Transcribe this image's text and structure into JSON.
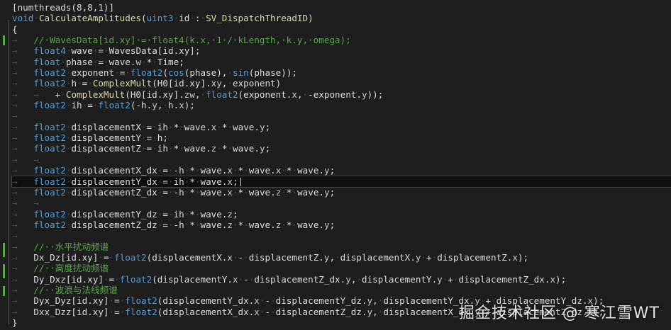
{
  "editor": {
    "lines": [
      [
        [
          "pl",
          "[numthreads(8,8,1)]"
        ]
      ],
      [
        [
          "kw",
          "void"
        ],
        [
          "ws",
          "·"
        ],
        [
          "fn",
          "CalculateAmplitudes"
        ],
        [
          "pl",
          "("
        ],
        [
          "kw",
          "uint3"
        ],
        [
          "ws",
          "·"
        ],
        [
          "id",
          "id"
        ],
        [
          "ws",
          "·"
        ],
        [
          "pl",
          ":"
        ],
        [
          "ws",
          "·"
        ],
        [
          "sm",
          "SV_DispatchThreadID"
        ],
        [
          "pl",
          ")"
        ]
      ],
      [
        [
          "pl",
          "{"
        ]
      ],
      [
        [
          "ws",
          "→   "
        ],
        [
          "cm",
          "//·WavesData[id.xy]·=·float4(k.x,·1·/·kLength,·k.y,·omega);"
        ]
      ],
      [
        [
          "ws",
          "→   "
        ],
        [
          "kw",
          "float4"
        ],
        [
          "ws",
          "·"
        ],
        [
          "id",
          "wave"
        ],
        [
          "ws",
          "·"
        ],
        [
          "pl",
          "="
        ],
        [
          "ws",
          "·"
        ],
        [
          "id",
          "WavesData[id.xy];"
        ]
      ],
      [
        [
          "ws",
          "→   "
        ],
        [
          "kw",
          "float"
        ],
        [
          "ws",
          "·"
        ],
        [
          "id",
          "phase"
        ],
        [
          "ws",
          "·"
        ],
        [
          "pl",
          "="
        ],
        [
          "ws",
          "·"
        ],
        [
          "id",
          "wave."
        ],
        [
          "mb",
          "w"
        ],
        [
          "ws",
          "·"
        ],
        [
          "pl",
          "*"
        ],
        [
          "ws",
          "·"
        ],
        [
          "id",
          "Time;"
        ]
      ],
      [
        [
          "ws",
          "→   "
        ],
        [
          "kw",
          "float2"
        ],
        [
          "ws",
          "·"
        ],
        [
          "id",
          "exponent"
        ],
        [
          "ws",
          "·"
        ],
        [
          "pl",
          "="
        ],
        [
          "ws",
          "·"
        ],
        [
          "kw",
          "float2"
        ],
        [
          "pl",
          "("
        ],
        [
          "kw",
          "cos"
        ],
        [
          "pl",
          "(phase),"
        ],
        [
          "ws",
          "·"
        ],
        [
          "kw",
          "sin"
        ],
        [
          "pl",
          "(phase));"
        ]
      ],
      [
        [
          "ws",
          "→   "
        ],
        [
          "kw",
          "float2"
        ],
        [
          "ws",
          "·"
        ],
        [
          "id",
          "h"
        ],
        [
          "ws",
          "·"
        ],
        [
          "pl",
          "="
        ],
        [
          "ws",
          "·"
        ],
        [
          "fn",
          "ComplexMult"
        ],
        [
          "pl",
          "(H0[id.xy]."
        ],
        [
          "mb",
          "xy"
        ],
        [
          "pl",
          ","
        ],
        [
          "ws",
          "·"
        ],
        [
          "id",
          "exponent)"
        ]
      ],
      [
        [
          "ws",
          "→   →   "
        ],
        [
          "pl",
          "+"
        ],
        [
          "ws",
          "·"
        ],
        [
          "fn",
          "ComplexMult"
        ],
        [
          "pl",
          "(H0[id.xy]."
        ],
        [
          "mb",
          "zw"
        ],
        [
          "pl",
          ","
        ],
        [
          "ws",
          "·"
        ],
        [
          "kw",
          "float2"
        ],
        [
          "pl",
          "(exponent."
        ],
        [
          "mb",
          "x"
        ],
        [
          "pl",
          ","
        ],
        [
          "ws",
          "·"
        ],
        [
          "pl",
          "-exponent."
        ],
        [
          "mb",
          "y"
        ],
        [
          "pl",
          "));"
        ]
      ],
      [
        [
          "ws",
          "→   "
        ],
        [
          "kw",
          "float2"
        ],
        [
          "ws",
          "·"
        ],
        [
          "id",
          "ih"
        ],
        [
          "ws",
          "·"
        ],
        [
          "pl",
          "="
        ],
        [
          "ws",
          "·"
        ],
        [
          "kw",
          "float2"
        ],
        [
          "pl",
          "(-h."
        ],
        [
          "mb",
          "y"
        ],
        [
          "pl",
          ","
        ],
        [
          "ws",
          "·"
        ],
        [
          "pl",
          "h."
        ],
        [
          "mb",
          "x"
        ],
        [
          "pl",
          ");"
        ]
      ],
      [
        [
          "ws",
          "→   "
        ]
      ],
      [
        [
          "ws",
          "→   "
        ],
        [
          "kw",
          "float2"
        ],
        [
          "ws",
          "·"
        ],
        [
          "id",
          "displacementX"
        ],
        [
          "ws",
          "·"
        ],
        [
          "pl",
          "="
        ],
        [
          "ws",
          "·"
        ],
        [
          "id",
          "ih"
        ],
        [
          "ws",
          "·"
        ],
        [
          "pl",
          "*"
        ],
        [
          "ws",
          "·"
        ],
        [
          "id",
          "wave."
        ],
        [
          "mb",
          "x"
        ],
        [
          "ws",
          "·"
        ],
        [
          "pl",
          "*"
        ],
        [
          "ws",
          "·"
        ],
        [
          "id",
          "wave."
        ],
        [
          "mb",
          "y"
        ],
        [
          "pl",
          ";"
        ]
      ],
      [
        [
          "ws",
          "→   "
        ],
        [
          "kw",
          "float2"
        ],
        [
          "ws",
          "·"
        ],
        [
          "id",
          "displacementY"
        ],
        [
          "ws",
          "·"
        ],
        [
          "pl",
          "="
        ],
        [
          "ws",
          "·"
        ],
        [
          "id",
          "h;"
        ]
      ],
      [
        [
          "ws",
          "→   "
        ],
        [
          "kw",
          "float2"
        ],
        [
          "ws",
          "·"
        ],
        [
          "id",
          "displacementZ"
        ],
        [
          "ws",
          "·"
        ],
        [
          "pl",
          "="
        ],
        [
          "ws",
          "·"
        ],
        [
          "id",
          "ih"
        ],
        [
          "ws",
          "·"
        ],
        [
          "pl",
          "*"
        ],
        [
          "ws",
          "·"
        ],
        [
          "id",
          "wave."
        ],
        [
          "mb",
          "z"
        ],
        [
          "ws",
          "·"
        ],
        [
          "pl",
          "*"
        ],
        [
          "ws",
          "·"
        ],
        [
          "id",
          "wave."
        ],
        [
          "mb",
          "y"
        ],
        [
          "pl",
          ";"
        ]
      ],
      [
        [
          "ws",
          "→   →"
        ]
      ],
      [
        [
          "ws",
          "→   "
        ],
        [
          "kw",
          "float2"
        ],
        [
          "ws",
          "·"
        ],
        [
          "id",
          "displacementX_dx"
        ],
        [
          "ws",
          "·"
        ],
        [
          "pl",
          "="
        ],
        [
          "ws",
          "·"
        ],
        [
          "pl",
          "-h"
        ],
        [
          "ws",
          "·"
        ],
        [
          "pl",
          "*"
        ],
        [
          "ws",
          "·"
        ],
        [
          "id",
          "wave."
        ],
        [
          "mb",
          "x"
        ],
        [
          "ws",
          "·"
        ],
        [
          "pl",
          "*"
        ],
        [
          "ws",
          "·"
        ],
        [
          "id",
          "wave."
        ],
        [
          "mb",
          "x"
        ],
        [
          "ws",
          "·"
        ],
        [
          "pl",
          "*"
        ],
        [
          "ws",
          "·"
        ],
        [
          "id",
          "wave."
        ],
        [
          "mb",
          "y"
        ],
        [
          "pl",
          ";"
        ]
      ],
      [
        [
          "ws",
          "→   "
        ],
        [
          "kw",
          "float2"
        ],
        [
          "ws",
          "·"
        ],
        [
          "id",
          "displacementY_dx"
        ],
        [
          "ws",
          "·"
        ],
        [
          "pl",
          "="
        ],
        [
          "ws",
          "·"
        ],
        [
          "id",
          "ih"
        ],
        [
          "ws",
          "·"
        ],
        [
          "pl",
          "*"
        ],
        [
          "ws",
          "·"
        ],
        [
          "id",
          "wave."
        ],
        [
          "mb",
          "x"
        ],
        [
          "pl",
          ";"
        ]
      ],
      [
        [
          "ws",
          "→   "
        ],
        [
          "kw",
          "float2"
        ],
        [
          "ws",
          "·"
        ],
        [
          "id",
          "displacementZ_dx"
        ],
        [
          "ws",
          "·"
        ],
        [
          "pl",
          "="
        ],
        [
          "ws",
          "·"
        ],
        [
          "pl",
          "-h"
        ],
        [
          "ws",
          "·"
        ],
        [
          "pl",
          "*"
        ],
        [
          "ws",
          "·"
        ],
        [
          "id",
          "wave."
        ],
        [
          "mb",
          "x"
        ],
        [
          "ws",
          "·"
        ],
        [
          "pl",
          "*"
        ],
        [
          "ws",
          "·"
        ],
        [
          "id",
          "wave."
        ],
        [
          "mb",
          "z"
        ],
        [
          "ws",
          "·"
        ],
        [
          "pl",
          "*"
        ],
        [
          "ws",
          "·"
        ],
        [
          "id",
          "wave."
        ],
        [
          "mb",
          "y"
        ],
        [
          "pl",
          ";"
        ]
      ],
      [
        [
          "ws",
          "→   →"
        ]
      ],
      [
        [
          "ws",
          "→   "
        ],
        [
          "kw",
          "float2"
        ],
        [
          "ws",
          "·"
        ],
        [
          "id",
          "displacementY_dz"
        ],
        [
          "ws",
          "·"
        ],
        [
          "pl",
          "="
        ],
        [
          "ws",
          "·"
        ],
        [
          "id",
          "ih"
        ],
        [
          "ws",
          "·"
        ],
        [
          "pl",
          "*"
        ],
        [
          "ws",
          "·"
        ],
        [
          "id",
          "wave."
        ],
        [
          "mb",
          "z"
        ],
        [
          "pl",
          ";"
        ]
      ],
      [
        [
          "ws",
          "→   "
        ],
        [
          "kw",
          "float2"
        ],
        [
          "ws",
          "·"
        ],
        [
          "id",
          "displacementZ_dz"
        ],
        [
          "ws",
          "·"
        ],
        [
          "pl",
          "="
        ],
        [
          "ws",
          "·"
        ],
        [
          "pl",
          "-h"
        ],
        [
          "ws",
          "·"
        ],
        [
          "pl",
          "*"
        ],
        [
          "ws",
          "·"
        ],
        [
          "id",
          "wave."
        ],
        [
          "mb",
          "z"
        ],
        [
          "ws",
          "·"
        ],
        [
          "pl",
          "*"
        ],
        [
          "ws",
          "·"
        ],
        [
          "id",
          "wave."
        ],
        [
          "mb",
          "z"
        ],
        [
          "ws",
          "·"
        ],
        [
          "pl",
          "*"
        ],
        [
          "ws",
          "·"
        ],
        [
          "id",
          "wave."
        ],
        [
          "mb",
          "y"
        ],
        [
          "pl",
          ";"
        ]
      ],
      [
        [
          "ws",
          "→   "
        ]
      ],
      [
        [
          "ws",
          "→   "
        ],
        [
          "cm",
          "//··水平扰动频谱"
        ]
      ],
      [
        [
          "ws",
          "→   "
        ],
        [
          "id",
          "Dx_Dz[id.xy]"
        ],
        [
          "ws",
          "·"
        ],
        [
          "pl",
          "="
        ],
        [
          "ws",
          "·"
        ],
        [
          "kw",
          "float2"
        ],
        [
          "pl",
          "(displacementX."
        ],
        [
          "mb",
          "x"
        ],
        [
          "ws",
          "·"
        ],
        [
          "pl",
          "-"
        ],
        [
          "ws",
          "·"
        ],
        [
          "id",
          "displacementZ."
        ],
        [
          "mb",
          "y"
        ],
        [
          "pl",
          ","
        ],
        [
          "ws",
          "·"
        ],
        [
          "id",
          "displacementX."
        ],
        [
          "mb",
          "y"
        ],
        [
          "ws",
          "·"
        ],
        [
          "pl",
          "+"
        ],
        [
          "ws",
          "·"
        ],
        [
          "id",
          "displacementZ."
        ],
        [
          "mb",
          "x"
        ],
        [
          "pl",
          ");"
        ]
      ],
      [
        [
          "ws",
          "→   "
        ],
        [
          "cm",
          "//··高度扰动频谱"
        ]
      ],
      [
        [
          "ws",
          "→   "
        ],
        [
          "id",
          "Dy_Dxz[id.xy]"
        ],
        [
          "ws",
          "·"
        ],
        [
          "pl",
          "="
        ],
        [
          "ws",
          "·"
        ],
        [
          "kw",
          "float2"
        ],
        [
          "pl",
          "(displacementY."
        ],
        [
          "mb",
          "x"
        ],
        [
          "ws",
          "·"
        ],
        [
          "pl",
          "-"
        ],
        [
          "ws",
          "·"
        ],
        [
          "id",
          "displacementZ_dx."
        ],
        [
          "mb",
          "y"
        ],
        [
          "pl",
          ","
        ],
        [
          "ws",
          "·"
        ],
        [
          "id",
          "displacementY."
        ],
        [
          "mb",
          "y"
        ],
        [
          "ws",
          "·"
        ],
        [
          "pl",
          "+"
        ],
        [
          "ws",
          "·"
        ],
        [
          "id",
          "displacementZ_dx."
        ],
        [
          "mb",
          "x"
        ],
        [
          "pl",
          ");"
        ]
      ],
      [
        [
          "ws",
          "→   "
        ],
        [
          "cm",
          "//··波浪与法线频谱"
        ]
      ],
      [
        [
          "ws",
          "→   "
        ],
        [
          "id",
          "Dyx_Dyz[id.xy]"
        ],
        [
          "ws",
          "·"
        ],
        [
          "pl",
          "="
        ],
        [
          "ws",
          "·"
        ],
        [
          "kw",
          "float2"
        ],
        [
          "pl",
          "(displacementY_dx."
        ],
        [
          "mb",
          "x"
        ],
        [
          "ws",
          "·"
        ],
        [
          "pl",
          "-"
        ],
        [
          "ws",
          "·"
        ],
        [
          "id",
          "displacementY_dz."
        ],
        [
          "mb",
          "y"
        ],
        [
          "pl",
          ","
        ],
        [
          "ws",
          "·"
        ],
        [
          "id",
          "displacementY_dx."
        ],
        [
          "mb",
          "y"
        ],
        [
          "ws",
          "·"
        ],
        [
          "pl",
          "+"
        ],
        [
          "ws",
          "·"
        ],
        [
          "id",
          "displacementY_dz."
        ],
        [
          "mb",
          "x"
        ],
        [
          "pl",
          ");"
        ]
      ],
      [
        [
          "ws",
          "→   "
        ],
        [
          "id",
          "Dxx_Dzz[id.xy]"
        ],
        [
          "ws",
          "·"
        ],
        [
          "pl",
          "="
        ],
        [
          "ws",
          "·"
        ],
        [
          "kw",
          "float2"
        ],
        [
          "pl",
          "(displacementX_dx."
        ],
        [
          "mb",
          "x"
        ],
        [
          "ws",
          "·"
        ],
        [
          "pl",
          "-"
        ],
        [
          "ws",
          "·"
        ],
        [
          "id",
          "displacementZ_dz."
        ],
        [
          "mb",
          "y"
        ],
        [
          "pl",
          ","
        ],
        [
          "ws",
          "·"
        ],
        [
          "id",
          "displacementX_dx."
        ],
        [
          "mb",
          "y"
        ],
        [
          "ws",
          "·"
        ],
        [
          "pl",
          "+"
        ],
        [
          "ws",
          "·"
        ],
        [
          "id",
          "displacementZ_dz."
        ],
        [
          "mb",
          "x"
        ],
        [
          "pl",
          ");"
        ]
      ],
      [
        [
          "pl",
          "}"
        ]
      ]
    ],
    "current_line_index": 16,
    "colors": {
      "background": "#1e1e1e",
      "keyword": "#569cd6",
      "function": "#dcdcaa",
      "comment": "#57a64a",
      "text": "#dcdcdc",
      "whitespace_marker": "#4a4a4a"
    }
  },
  "watermark": "掘金技术社区 @ 寒江雪WT"
}
